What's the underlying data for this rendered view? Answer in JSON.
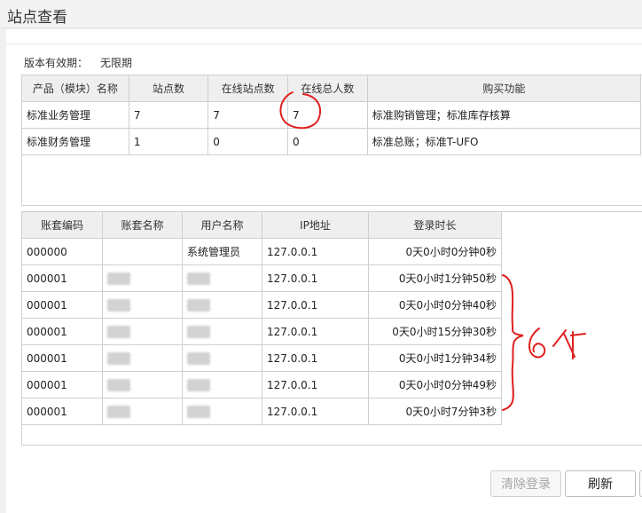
{
  "window": {
    "title": "站点查看"
  },
  "version": {
    "label": "版本有效期：",
    "value": "无限期"
  },
  "product_table": {
    "headers": [
      "产品（模块）名称",
      "站点数",
      "在线站点数",
      "在线总人数",
      "购买功能"
    ],
    "rows": [
      [
        "标准业务管理",
        "7",
        "7",
        "7",
        "标准购销管理；标准库存核算"
      ],
      [
        "标准财务管理",
        "1",
        "0",
        "0",
        "标准总账；标准T-UFO"
      ]
    ]
  },
  "session_table": {
    "headers": [
      "账套编码",
      "账套名称",
      "用户名称",
      "IP地址",
      "登录时长"
    ],
    "rows": [
      {
        "code": "000000",
        "name": "",
        "user": "系统管理员",
        "ip": "127.0.0.1",
        "duration": "0天0小时0分钟0秒"
      },
      {
        "code": "000001",
        "name": "",
        "user": "",
        "ip": "127.0.0.1",
        "duration": "0天0小时1分钟50秒"
      },
      {
        "code": "000001",
        "name": "",
        "user": "",
        "ip": "127.0.0.1",
        "duration": "0天0小时0分钟40秒"
      },
      {
        "code": "000001",
        "name": "",
        "user": "",
        "ip": "127.0.0.1",
        "duration": "0天0小时15分钟30秒"
      },
      {
        "code": "000001",
        "name": "",
        "user": "",
        "ip": "127.0.0.1",
        "duration": "0天0小时1分钟34秒"
      },
      {
        "code": "000001",
        "name": "",
        "user": "",
        "ip": "127.0.0.1",
        "duration": "0天0小时0分钟49秒"
      },
      {
        "code": "000001",
        "name": "",
        "user": "",
        "ip": "127.0.0.1",
        "duration": "0天0小时7分钟3秒"
      }
    ]
  },
  "buttons": {
    "clear_login": "清除登录",
    "refresh": "刷新"
  },
  "annotation": {
    "text": "6个",
    "color": "#e02020"
  }
}
